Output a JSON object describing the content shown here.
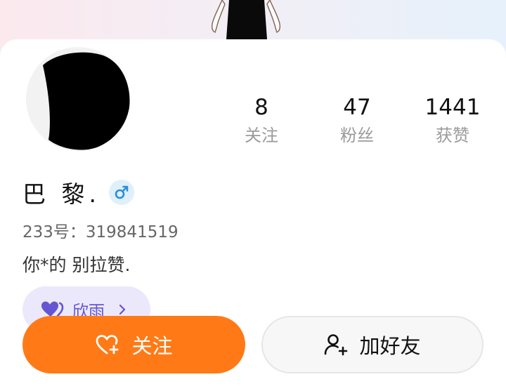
{
  "profile": {
    "name": "巴 黎.",
    "gender_icon": "male-icon",
    "uid": "233号：319841519",
    "signature": "你*的 别拉赞."
  },
  "stats": [
    {
      "value": "8",
      "label": "关注"
    },
    {
      "value": "47",
      "label": "粉丝"
    },
    {
      "value": "1441",
      "label": "获赞"
    }
  ],
  "tag": {
    "icon": "double-heart-icon",
    "label": "欣雨"
  },
  "buttons": {
    "follow_label": "关注",
    "add_friend_label": "加好友"
  },
  "colors": {
    "follow_button": "#ff7a16",
    "tag_background": "#ebe8fb",
    "tag_accent": "#6555d2",
    "gender_badge": "#dff0fb",
    "gender_icon": "#2b8fd6"
  }
}
